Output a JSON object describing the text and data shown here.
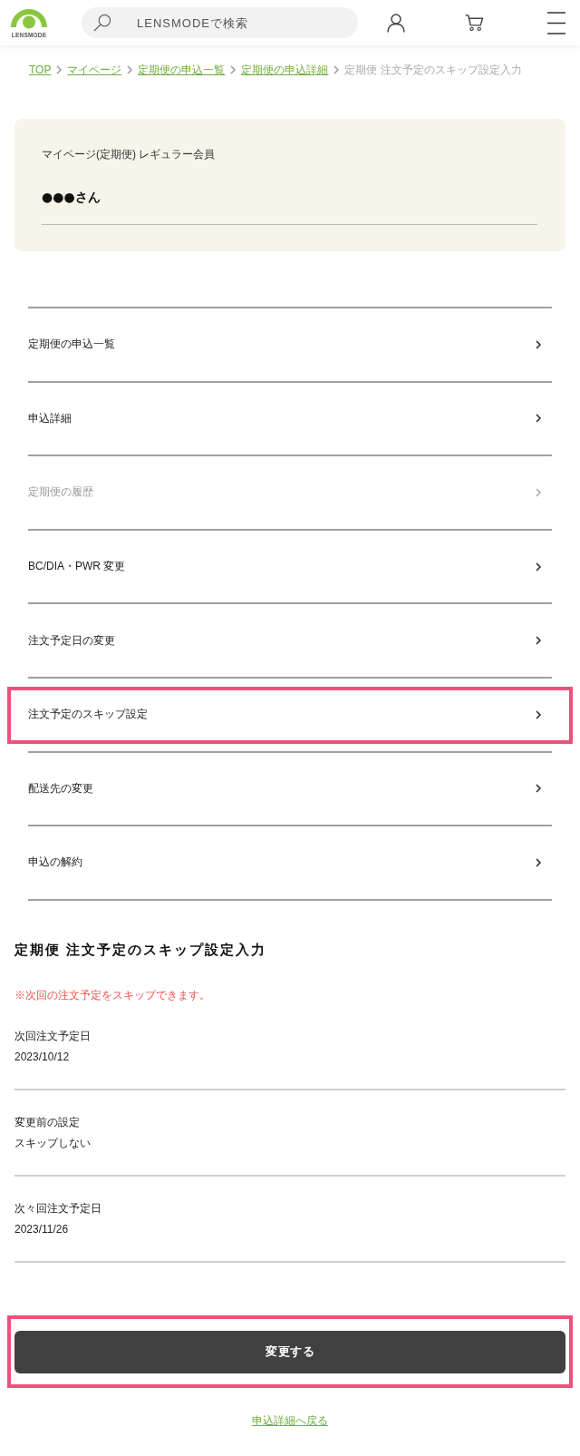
{
  "header": {
    "logo": {
      "text": "LENSMODE"
    },
    "search": {
      "placeholder": "LENSMODEで検索"
    }
  },
  "breadcrumb": [
    {
      "label": "TOP",
      "kind": "link"
    },
    {
      "label": "マイページ",
      "kind": "link"
    },
    {
      "label": "定期便の申込一覧",
      "kind": "link"
    },
    {
      "label": "定期便の申込詳細",
      "kind": "link"
    },
    {
      "label": "定期便 注文予定のスキップ設定入力",
      "kind": "current"
    }
  ],
  "member_card": {
    "plan": "マイページ(定期便) レギュラー会員",
    "name": "●●●さん"
  },
  "menu": [
    {
      "label": "定期便の申込一覧",
      "disabled": false,
      "highlighted": false
    },
    {
      "label": "申込詳細",
      "disabled": false,
      "highlighted": false
    },
    {
      "label": "定期便の履歴",
      "disabled": true,
      "highlighted": false
    },
    {
      "label": "BC/DIA・PWR 変更",
      "disabled": false,
      "highlighted": false
    },
    {
      "label": "注文予定日の変更",
      "disabled": false,
      "highlighted": false
    },
    {
      "label": "注文予定のスキップ設定",
      "disabled": false,
      "highlighted": true
    },
    {
      "label": "配送先の変更",
      "disabled": false,
      "highlighted": false
    },
    {
      "label": "申込の解約",
      "disabled": false,
      "highlighted": false
    }
  ],
  "form": {
    "title": "定期便 注文予定のスキップ設定入力",
    "note": "※次回の注文予定をスキップできます。",
    "fields": [
      {
        "label": "次回注文予定日",
        "value": "2023/10/12"
      },
      {
        "label": "変更前の設定",
        "value": "スキップしない"
      },
      {
        "label": "次々回注文予定日",
        "value": "2023/11/26"
      }
    ]
  },
  "submit_button": {
    "label": "変更する",
    "highlighted": true
  },
  "back_link": {
    "label": "申込詳細へ戻る"
  }
}
